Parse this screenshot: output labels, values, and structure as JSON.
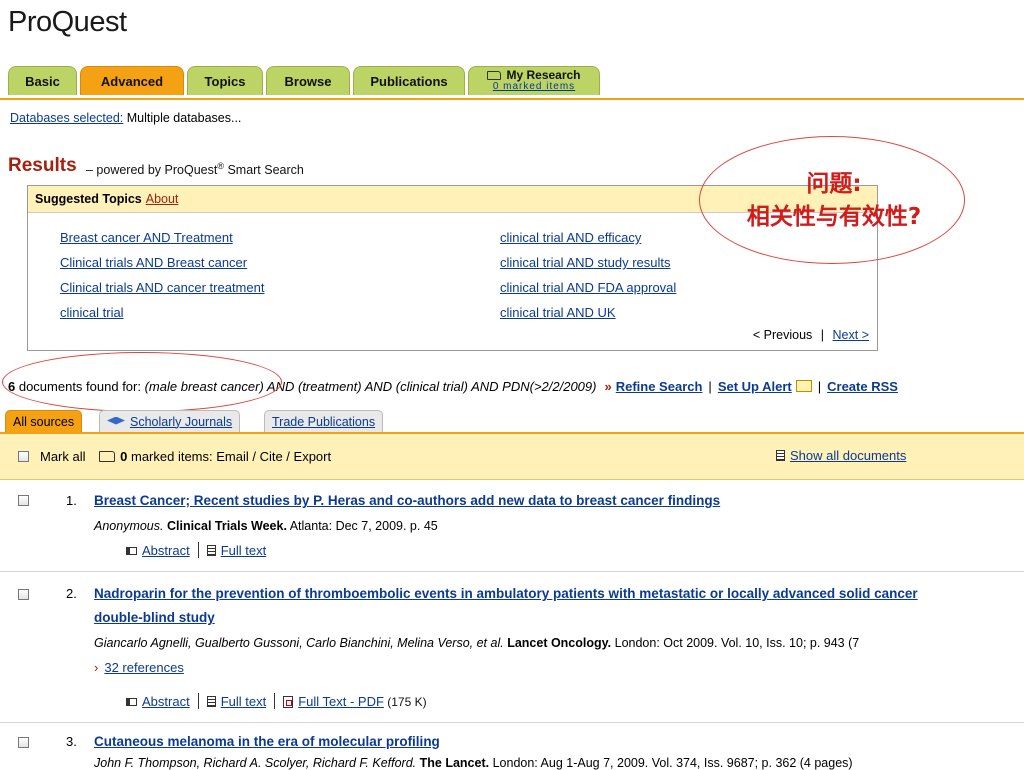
{
  "logo": "ProQuest",
  "tabs": [
    {
      "label": "Basic"
    },
    {
      "label": "Advanced"
    },
    {
      "label": "Topics"
    },
    {
      "label": "Browse"
    },
    {
      "label": "Publications"
    }
  ],
  "my_research": {
    "label": "My Research",
    "sub": "0 marked items"
  },
  "databases": {
    "link": "Databases selected:",
    "value": " Multiple databases..."
  },
  "results": {
    "title": "Results",
    "subtitle_a": "– powered by ProQuest",
    "reg": "®",
    "subtitle_b": " Smart Search"
  },
  "suggested": {
    "title": "Suggested Topics",
    "about": "About",
    "left": [
      "Breast cancer AND Treatment",
      "Clinical trials AND Breast cancer",
      "Clinical trials AND cancer treatment",
      "clinical trial"
    ],
    "right": [
      "clinical trial AND efficacy",
      "clinical trial AND study results",
      "clinical trial AND FDA approval",
      "clinical trial AND UK"
    ],
    "prev": "< Previous",
    "pipe": "|",
    "next": "Next >"
  },
  "callout": {
    "line1": "问题:",
    "line2": "相关性与有效性?"
  },
  "found": {
    "count": "6",
    "label": " documents found for: ",
    "query": "(male breast cancer) AND (treatment) AND (clinical trial) AND PDN(>2/2/2009)",
    "raquo": "»",
    "refine": "Refine Search",
    "alert": "Set Up Alert",
    "create": "Create RSS",
    "pipe": "|"
  },
  "source_tabs": {
    "all": "All sources",
    "scholarly": "Scholarly Journals",
    "trade": "Trade Publications"
  },
  "toolbar": {
    "mark_all": "Mark all",
    "marked_count": "0",
    "marked_text": " marked items: Email / Cite / Export",
    "show_all": "Show all documents"
  },
  "results_list": [
    {
      "num": "1.",
      "title": "Breast Cancer; Recent studies by P. Heras and co-authors add new data to breast cancer findings",
      "author": "Anonymous.",
      "pub": "Clinical Trials Week.",
      "rest": " Atlanta: Dec 7, 2009. p. 45",
      "abstract": "Abstract",
      "fulltext": "Full text"
    },
    {
      "num": "2.",
      "title": "Nadroparin for the prevention of thromboembolic events in ambulatory patients with metastatic or locally advanced solid cancer",
      "title2": "double-blind study",
      "author": "Giancarlo Agnelli, Gualberto Gussoni, Carlo Bianchini, Melina Verso, et al.",
      "pub": "Lancet Oncology.",
      "rest": " London: Oct 2009. Vol. 10, Iss. 10; p. 943 (7",
      "refs": "32 references",
      "refs_arrow": "›",
      "abstract": "Abstract",
      "fulltext": "Full text",
      "pdf": "Full Text - PDF",
      "pdf_size": " (175 K)"
    },
    {
      "num": "3.",
      "title": "Cutaneous melanoma in the era of molecular profiling",
      "author": "John F. Thompson, Richard A. Scolyer, Richard F. Kefford.",
      "pub": "The Lancet.",
      "rest": " London: Aug 1-Aug 7, 2009. Vol. 374, Iss. 9687; p. 362 (4 pages)"
    }
  ],
  "colors": {
    "tab_green": "#bcd365",
    "tab_orange": "#f5a114",
    "toolbar_bg": "#fff1b8",
    "link": "#0b3a93",
    "accent_red": "#a3210e",
    "callout_red": "#d21c1c"
  }
}
